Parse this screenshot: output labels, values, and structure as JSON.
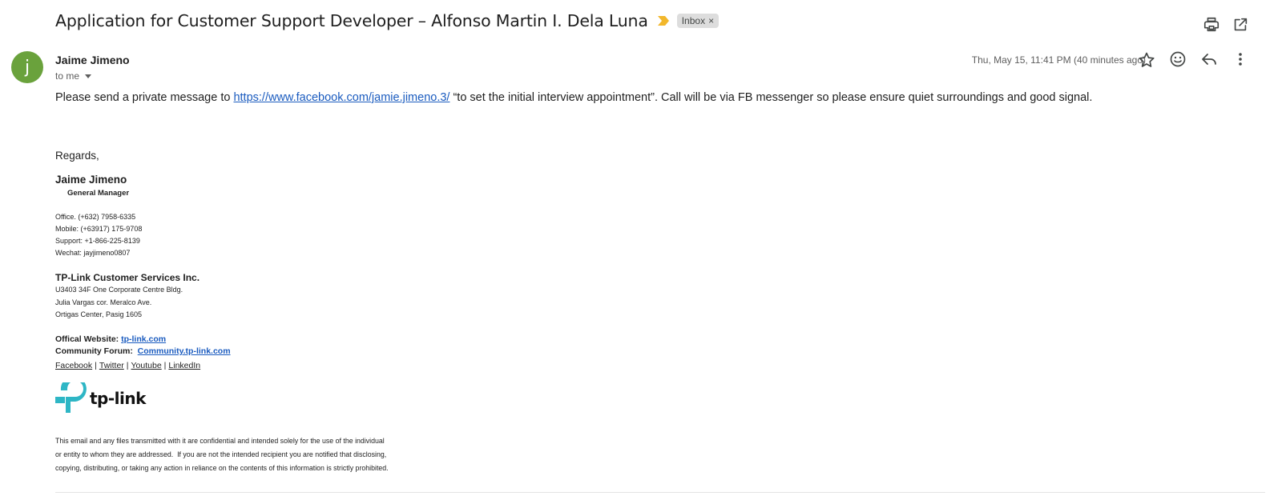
{
  "email": {
    "subject": "Application for Customer Support Developer – Alfonso Martin I. Dela Luna",
    "label": "Inbox",
    "label_remove": "×",
    "sender": {
      "initial": "j",
      "name": "Jaime Jimeno",
      "avatar_color": "#6aa23c"
    },
    "recipient": "to me",
    "date": "Thu, May 15, 11:41 PM (40 minutes ago)",
    "body": {
      "pre_link": "Please send a private message to ",
      "link": "https://www.facebook.com/jamie.jimeno.3/",
      "post_link": " “to set the initial interview appointment”. Call will be via FB messenger so please ensure quiet surroundings and good signal."
    },
    "signature": {
      "regards": "Regards,",
      "name": "Jaime Jimeno",
      "title": "General Manager",
      "contacts": [
        "Office.  (+632) 7958-6335",
        "Mobile: (+63917) 175-9708",
        "Support: +1-866-225-8139",
        "Wechat: jayjimeno0807"
      ],
      "company": "TP-Link Customer Services Inc.",
      "address": [
        "U3403 34F One Corporate Centre Bldg.",
        "Julia Vargas cor. Meralco Ave.",
        "Ortigas Center, Pasig 1605"
      ],
      "website_label": "Offical Website: ",
      "website_link": "tp-link.com",
      "forum_label": "Community Forum:  ",
      "forum_link": "Community.tp-link.com",
      "social": [
        "Facebook",
        "Twitter",
        "Youtube",
        "LinkedIn"
      ],
      "social_sep": "|",
      "logo_text": "tp-link"
    },
    "disclaimer": [
      "This email and any files transmitted with it are confidential and intended solely for the use of the individual",
      "or entity to whom they are addressed.  If you are not the intended recipient you are notified that disclosing,",
      "copying, distributing, or taking any action in reliance on the contents of this information is strictly prohibited."
    ]
  },
  "icons": {
    "importance": "importance-marker-icon",
    "print": "print-icon",
    "open_new_window": "open-in-new-window-icon",
    "star": "star-icon",
    "emoji": "emoji-reaction-icon",
    "reply": "reply-icon",
    "more": "more-vertical-icon"
  },
  "colors": {
    "link": "#1a5bbf",
    "importance": "#f2b72b",
    "logo": "#2eb6c5"
  }
}
